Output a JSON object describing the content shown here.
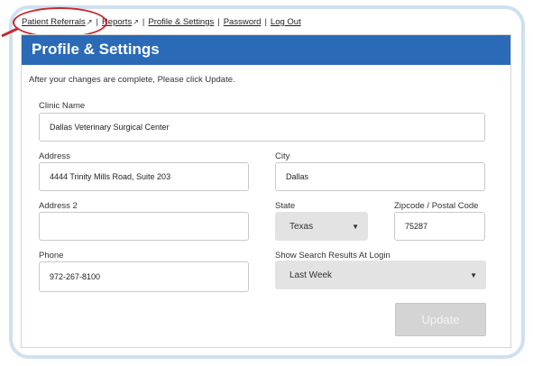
{
  "nav": {
    "links": [
      {
        "label": "Patient Referrals",
        "external": true
      },
      {
        "label": "Reports",
        "external": true
      },
      {
        "label": "Profile & Settings",
        "external": false
      },
      {
        "label": "Password",
        "external": false
      },
      {
        "label": "Log Out",
        "external": false
      }
    ],
    "separator": "|",
    "external_icon": "↗"
  },
  "panel": {
    "title": "Profile & Settings",
    "instructions": "After your changes are complete, Please click Update."
  },
  "form": {
    "clinic_name": {
      "label": "Clinic Name",
      "value": "Dallas Veterinary Surgical Center"
    },
    "address": {
      "label": "Address",
      "value": "4444 Trinity Mills Road, Suite 203"
    },
    "city": {
      "label": "City",
      "value": "Dallas"
    },
    "address2": {
      "label": "Address 2",
      "value": ""
    },
    "state": {
      "label": "State",
      "value": "Texas"
    },
    "zip": {
      "label": "Zipcode / Postal Code",
      "value": "75287"
    },
    "phone": {
      "label": "Phone",
      "value": "972-267-8100"
    },
    "search_results": {
      "label": "Show Search Results At Login",
      "value": "Last Week"
    },
    "update_label": "Update"
  },
  "icons": {
    "dropdown": "chevron-down-icon",
    "external": "external-link-icon"
  },
  "colors": {
    "header": "#2a6ab7",
    "highlight": "#c8282e",
    "frame": "#cfe0f0"
  }
}
